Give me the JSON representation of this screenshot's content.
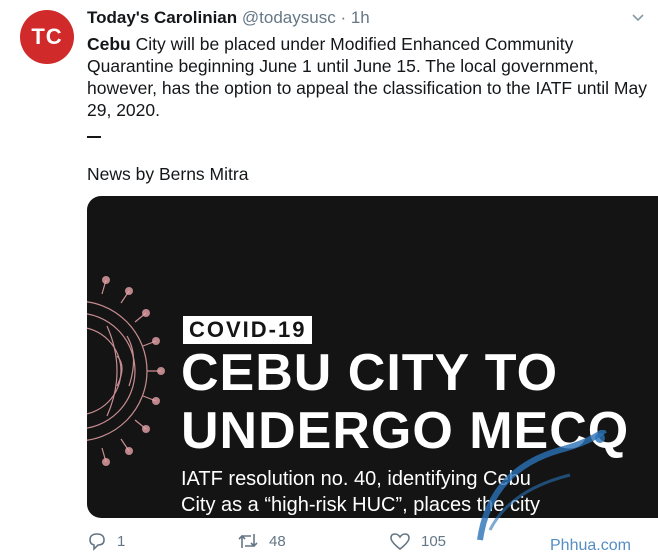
{
  "tweet": {
    "avatar_text": "TC",
    "display_name": "Today's Carolinian",
    "handle": "@todaysusc",
    "separator": "·",
    "time": "1h",
    "text_bold": "Cebu",
    "text_rest": " City will be placed under Modified Enhanced Community Quarantine beginning June 1 until June 15. The local government, however, has the option to appeal the classification to the IATF until May 29, 2020.",
    "byline": "News by Berns Mitra"
  },
  "media": {
    "badge": "COVID-19",
    "headline_line1": "CEBU CITY TO",
    "headline_line2": "UNDERGO MECQ",
    "sub_line1": "IATF resolution no. 40, identifying Cebu",
    "sub_line2": "City as a “high-risk HUC”, places the city"
  },
  "actions": {
    "reply_count": "1",
    "retweet_count": "48",
    "like_count": "105"
  },
  "watermark": {
    "text": "Phhua.com"
  },
  "colors": {
    "brand": "#d12a2a",
    "media_bg": "#141414",
    "virus": "#e7a3a9",
    "watermark": "#2a72b5"
  }
}
